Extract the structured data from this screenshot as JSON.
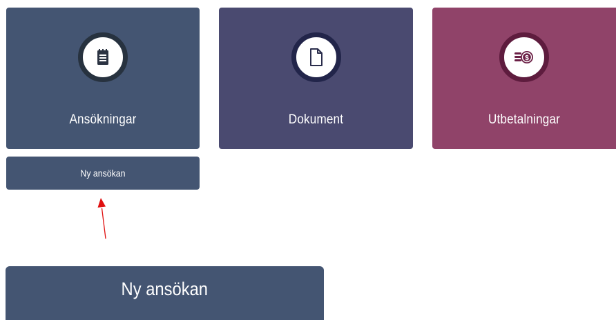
{
  "tiles": [
    {
      "label": "Ansökningar",
      "icon": "notepad-icon",
      "color": "#445572"
    },
    {
      "label": "Dokument",
      "icon": "document-icon",
      "color": "#4a4a70"
    },
    {
      "label": "Utbetalningar",
      "icon": "coins-icon",
      "color": "#904369"
    }
  ],
  "new_application_button": {
    "label": "Ny ansökan"
  },
  "zoomed_button": {
    "label": "Ny ansökan"
  },
  "annotation": {
    "arrow_color": "#e01010"
  }
}
